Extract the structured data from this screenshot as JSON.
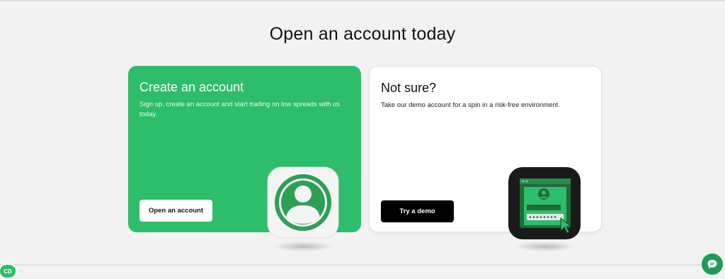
{
  "section": {
    "title": "Open an account today"
  },
  "cards": [
    {
      "title": "Create an account",
      "description": "Sign up, create an account and start trading on low spreads with us today.",
      "button_label": "Open an account",
      "icon": "user-profile-icon",
      "accent": "#2ebd6a"
    },
    {
      "title": "Not sure?",
      "description": "Take our demo account for a spin in a risk-free environment.",
      "button_label": "Try a demo",
      "icon": "demo-login-screen-icon",
      "accent": "#000000"
    }
  ],
  "widgets": {
    "badge_label": "CD",
    "chat_icon": "chat-bubble-icon"
  }
}
